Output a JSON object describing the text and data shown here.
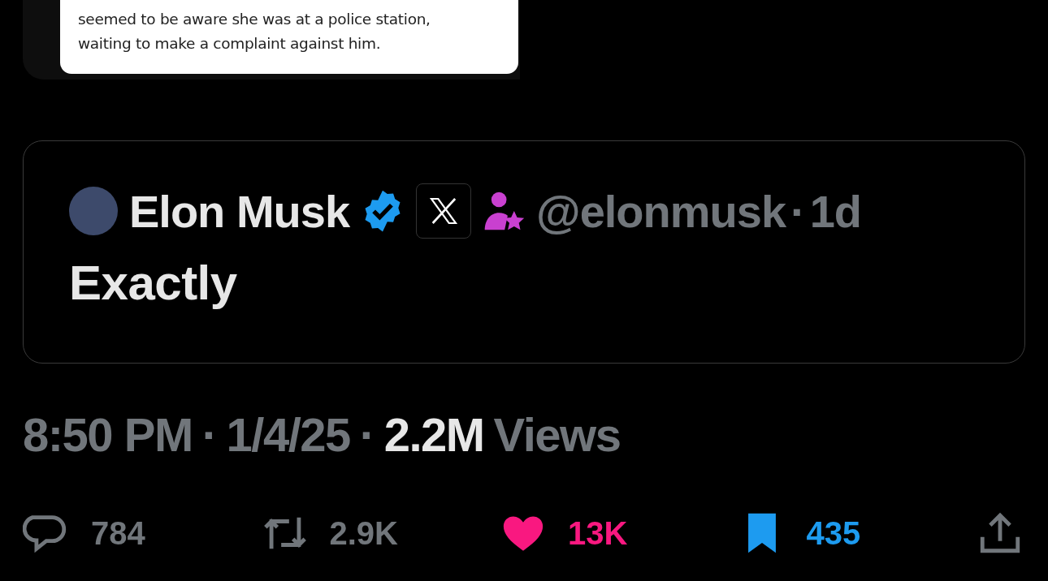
{
  "media_card": {
    "lines": [
      "seemed to be aware she was at a police station,",
      "waiting to make a complaint against him."
    ]
  },
  "quoted_post": {
    "author": "Elon Musk",
    "verified": true,
    "handle": "@elonmusk",
    "separator": "·",
    "age": "1d",
    "text": "Exactly"
  },
  "meta": {
    "time": "8:50 PM",
    "date": "1/4/25",
    "views_count": "2.2M",
    "views_label": "Views",
    "separators": [
      "·",
      "·"
    ]
  },
  "actions": [
    {
      "kind": "reply",
      "count": "784",
      "active": false
    },
    {
      "kind": "repost",
      "count": "2.9K",
      "active": false
    },
    {
      "kind": "like",
      "count": "13K",
      "active": true
    },
    {
      "kind": "bookmark",
      "count": "435",
      "active": true
    },
    {
      "kind": "share",
      "active": false
    }
  ]
}
